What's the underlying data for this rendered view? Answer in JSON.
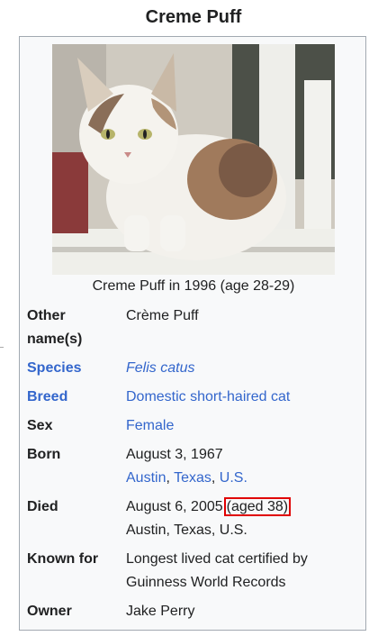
{
  "infobox": {
    "title": "Creme Puff",
    "image_alt": "photo of a white calico cat sitting on a white wooden fence",
    "caption": "Creme Puff in 1996 (age 28-29)",
    "other_names": {
      "label_line1": "Other",
      "label_line2": "name(s)",
      "value": "Crème Puff"
    },
    "species": {
      "label": "Species",
      "value": "Felis catus"
    },
    "breed": {
      "label": "Breed",
      "value": "Domestic short-haired cat"
    },
    "sex": {
      "label": "Sex",
      "value": "Female"
    },
    "born": {
      "label": "Born",
      "date": "August 3, 1967",
      "place_city": "Austin",
      "sep1": ", ",
      "place_state": "Texas",
      "sep2": ", ",
      "place_country": "U.S."
    },
    "died": {
      "label": "Died",
      "date": "August 6, 2005",
      "age": "(aged 38)",
      "place": "Austin, Texas, U.S."
    },
    "known_for": {
      "label": "Known for",
      "line1": "Longest lived cat certified by",
      "line2": "Guinness World Records"
    },
    "owner": {
      "label": "Owner",
      "value": "Jake Perry"
    }
  },
  "colors": {
    "link": "#3366cc",
    "highlight_border": "#e00000",
    "box_border": "#a2a9b1",
    "box_bg": "#f8f9fa"
  }
}
